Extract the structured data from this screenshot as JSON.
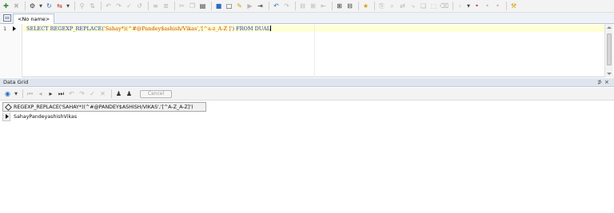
{
  "document_tab": {
    "label": "<No name>"
  },
  "editor": {
    "line_number": "1",
    "sql": {
      "select_kw": "SELECT",
      "func_kw": "REGEXP_REPLACE",
      "open_paren": "(",
      "arg1": "'Sahay*)(^#@Pandey$ashish/Vikas'",
      "comma": ",",
      "arg2": "'[^a-z_A-Z ]'",
      "close_paren": ")",
      "from_kw": "FROM",
      "table_kw": "DUAL"
    }
  },
  "data_grid": {
    "title": "Data Grid",
    "pin_glyph": "⊅",
    "close_glyph": "×",
    "cancel_label": "Cancel",
    "column_header": "REGEXP_REPLACE('SAHAY*)(^#@PANDEY$ASHISH/VIKAS','[^A-Z_A-Z]')",
    "rows": [
      {
        "value": "SahayPandeyashishVikas"
      }
    ]
  },
  "icons": {
    "main_toolbar": [
      "new-connection-icon",
      "disconnect-icon",
      "settings-icon",
      "reconnect-icon",
      "transaction-icon",
      "filter-icon",
      "sort-icon",
      "undo-icon",
      "redo-icon",
      "commit-icon",
      "rollback-icon",
      "format-icon",
      "unformat-icon",
      "cut-icon",
      "copy-icon",
      "paste-icon",
      "save-icon",
      "new-icon",
      "explain-icon",
      "run-icon",
      "indent-icon",
      "outdent-icon",
      "comment-icon",
      "uncomment-icon",
      "bookmark-icon",
      "grid-view-icon",
      "text-view-icon",
      "export-icon",
      "find-icon",
      "replace-icon",
      "goto-icon",
      "more-icon",
      "stop-icon",
      "tools-icon"
    ],
    "grid_toolbar": [
      "first-record-icon",
      "prev-record-icon",
      "next-record-icon",
      "last-record-icon",
      "insert-record-icon",
      "delete-record-icon",
      "post-icon",
      "refresh-icon",
      "user-icon",
      "group-icon"
    ]
  },
  "colors": {
    "keyword": "#1e3ea8",
    "string": "#c8461e",
    "current_line": "#ffffd6",
    "panel_header": "#dfe5ee"
  }
}
